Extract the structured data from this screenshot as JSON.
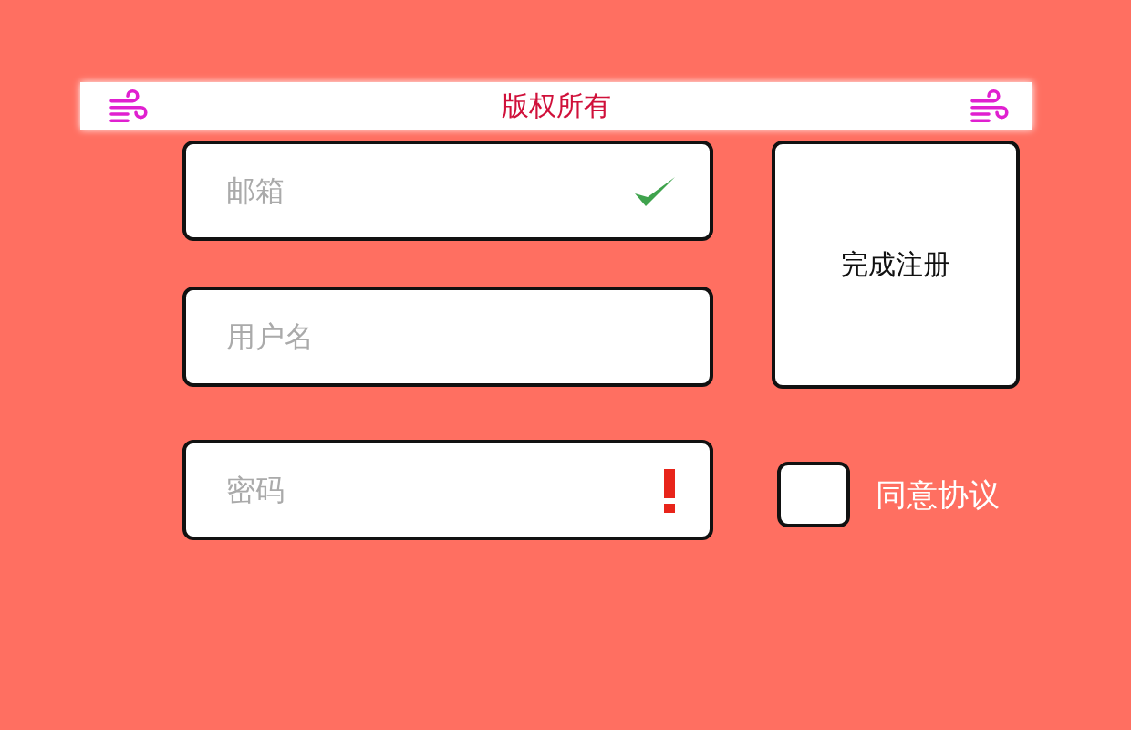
{
  "banner": {
    "title": "版权所有"
  },
  "fields": [
    {
      "placeholder": "邮箱",
      "kind": "valid"
    },
    {
      "placeholder": "用户名",
      "kind": "plain"
    },
    {
      "placeholder": "密码",
      "kind": "invalid"
    }
  ],
  "submit_button": {
    "label": "完成注册"
  },
  "agreement": {
    "label": "同意协议",
    "checked": false
  }
}
